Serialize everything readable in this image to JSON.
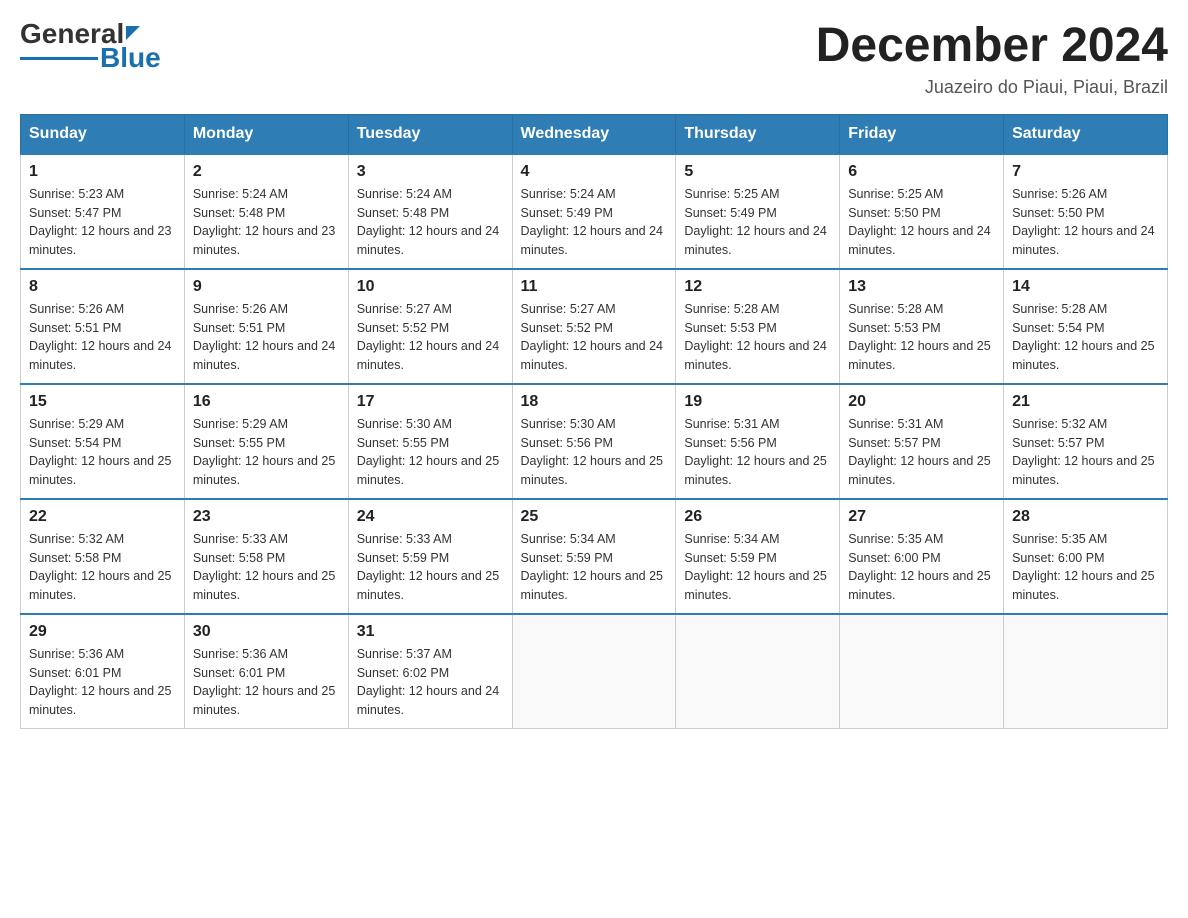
{
  "logo": {
    "text_general": "General",
    "text_blue": "Blue"
  },
  "title": "December 2024",
  "subtitle": "Juazeiro do Piaui, Piaui, Brazil",
  "days_of_week": [
    "Sunday",
    "Monday",
    "Tuesday",
    "Wednesday",
    "Thursday",
    "Friday",
    "Saturday"
  ],
  "weeks": [
    [
      {
        "day": "1",
        "sunrise": "5:23 AM",
        "sunset": "5:47 PM",
        "daylight": "12 hours and 23 minutes."
      },
      {
        "day": "2",
        "sunrise": "5:24 AM",
        "sunset": "5:48 PM",
        "daylight": "12 hours and 23 minutes."
      },
      {
        "day": "3",
        "sunrise": "5:24 AM",
        "sunset": "5:48 PM",
        "daylight": "12 hours and 24 minutes."
      },
      {
        "day": "4",
        "sunrise": "5:24 AM",
        "sunset": "5:49 PM",
        "daylight": "12 hours and 24 minutes."
      },
      {
        "day": "5",
        "sunrise": "5:25 AM",
        "sunset": "5:49 PM",
        "daylight": "12 hours and 24 minutes."
      },
      {
        "day": "6",
        "sunrise": "5:25 AM",
        "sunset": "5:50 PM",
        "daylight": "12 hours and 24 minutes."
      },
      {
        "day": "7",
        "sunrise": "5:26 AM",
        "sunset": "5:50 PM",
        "daylight": "12 hours and 24 minutes."
      }
    ],
    [
      {
        "day": "8",
        "sunrise": "5:26 AM",
        "sunset": "5:51 PM",
        "daylight": "12 hours and 24 minutes."
      },
      {
        "day": "9",
        "sunrise": "5:26 AM",
        "sunset": "5:51 PM",
        "daylight": "12 hours and 24 minutes."
      },
      {
        "day": "10",
        "sunrise": "5:27 AM",
        "sunset": "5:52 PM",
        "daylight": "12 hours and 24 minutes."
      },
      {
        "day": "11",
        "sunrise": "5:27 AM",
        "sunset": "5:52 PM",
        "daylight": "12 hours and 24 minutes."
      },
      {
        "day": "12",
        "sunrise": "5:28 AM",
        "sunset": "5:53 PM",
        "daylight": "12 hours and 24 minutes."
      },
      {
        "day": "13",
        "sunrise": "5:28 AM",
        "sunset": "5:53 PM",
        "daylight": "12 hours and 25 minutes."
      },
      {
        "day": "14",
        "sunrise": "5:28 AM",
        "sunset": "5:54 PM",
        "daylight": "12 hours and 25 minutes."
      }
    ],
    [
      {
        "day": "15",
        "sunrise": "5:29 AM",
        "sunset": "5:54 PM",
        "daylight": "12 hours and 25 minutes."
      },
      {
        "day": "16",
        "sunrise": "5:29 AM",
        "sunset": "5:55 PM",
        "daylight": "12 hours and 25 minutes."
      },
      {
        "day": "17",
        "sunrise": "5:30 AM",
        "sunset": "5:55 PM",
        "daylight": "12 hours and 25 minutes."
      },
      {
        "day": "18",
        "sunrise": "5:30 AM",
        "sunset": "5:56 PM",
        "daylight": "12 hours and 25 minutes."
      },
      {
        "day": "19",
        "sunrise": "5:31 AM",
        "sunset": "5:56 PM",
        "daylight": "12 hours and 25 minutes."
      },
      {
        "day": "20",
        "sunrise": "5:31 AM",
        "sunset": "5:57 PM",
        "daylight": "12 hours and 25 minutes."
      },
      {
        "day": "21",
        "sunrise": "5:32 AM",
        "sunset": "5:57 PM",
        "daylight": "12 hours and 25 minutes."
      }
    ],
    [
      {
        "day": "22",
        "sunrise": "5:32 AM",
        "sunset": "5:58 PM",
        "daylight": "12 hours and 25 minutes."
      },
      {
        "day": "23",
        "sunrise": "5:33 AM",
        "sunset": "5:58 PM",
        "daylight": "12 hours and 25 minutes."
      },
      {
        "day": "24",
        "sunrise": "5:33 AM",
        "sunset": "5:59 PM",
        "daylight": "12 hours and 25 minutes."
      },
      {
        "day": "25",
        "sunrise": "5:34 AM",
        "sunset": "5:59 PM",
        "daylight": "12 hours and 25 minutes."
      },
      {
        "day": "26",
        "sunrise": "5:34 AM",
        "sunset": "5:59 PM",
        "daylight": "12 hours and 25 minutes."
      },
      {
        "day": "27",
        "sunrise": "5:35 AM",
        "sunset": "6:00 PM",
        "daylight": "12 hours and 25 minutes."
      },
      {
        "day": "28",
        "sunrise": "5:35 AM",
        "sunset": "6:00 PM",
        "daylight": "12 hours and 25 minutes."
      }
    ],
    [
      {
        "day": "29",
        "sunrise": "5:36 AM",
        "sunset": "6:01 PM",
        "daylight": "12 hours and 25 minutes."
      },
      {
        "day": "30",
        "sunrise": "5:36 AM",
        "sunset": "6:01 PM",
        "daylight": "12 hours and 25 minutes."
      },
      {
        "day": "31",
        "sunrise": "5:37 AM",
        "sunset": "6:02 PM",
        "daylight": "12 hours and 24 minutes."
      },
      null,
      null,
      null,
      null
    ]
  ]
}
